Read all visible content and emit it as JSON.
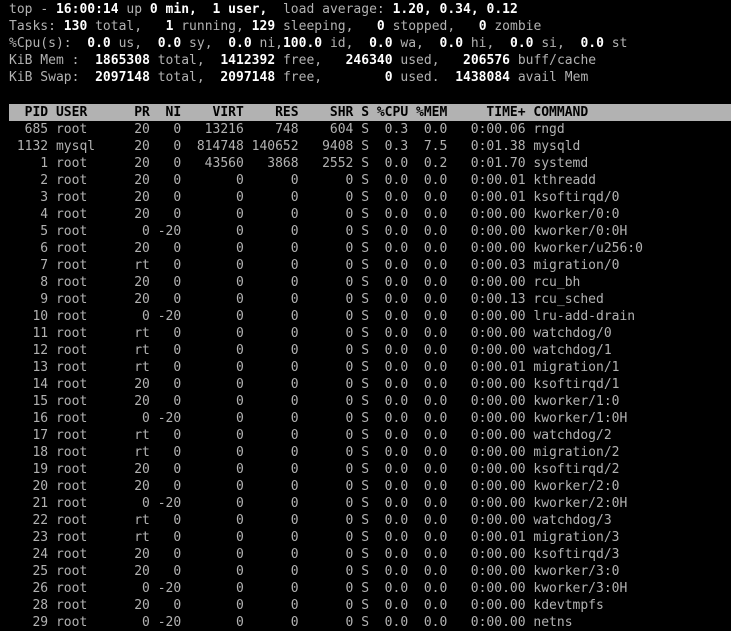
{
  "window": {
    "title": "top",
    "background_color": "#000000",
    "foreground_color": "#b2b2b2",
    "highlight_color": "#ffffff",
    "header_bar_bg": "#b2b2b2",
    "header_bar_fg": "#000000"
  },
  "summary": {
    "uptime_line": {
      "program": "top",
      "separator": "-",
      "time": "16:00:14",
      "up_label": "up",
      "uptime": "0 min,",
      "users": "1 user,",
      "load_label": "load average:",
      "load_1": "1.20,",
      "load_5": "0.34,",
      "load_15": "0.12",
      "full": "top - 16:00:14 up 0 min,  1 user,  load average: 1.20, 0.34, 0.12"
    },
    "tasks_line": {
      "label": "Tasks:",
      "total": "130",
      "total_label": "total,",
      "running": "1",
      "running_label": "running,",
      "sleeping": "129",
      "sleeping_label": "sleeping,",
      "stopped": "0",
      "stopped_label": "stopped,",
      "zombie": "0",
      "zombie_label": "zombie",
      "full": "Tasks: 130 total,   1 running, 129 sleeping,   0 stopped,   0 zombie"
    },
    "cpu_line": {
      "label": "%Cpu(s):",
      "us": "0.0",
      "us_label": "us,",
      "sy": "0.0",
      "sy_label": "sy,",
      "ni": "0.0",
      "ni_label": "ni,",
      "id": "100.0",
      "id_label": "id,",
      "wa": "0.0",
      "wa_label": "wa,",
      "hi": "0.0",
      "hi_label": "hi,",
      "si": "0.0",
      "si_label": "si,",
      "st": "0.0",
      "st_label": "st",
      "full": "%Cpu(s):  0.0 us,  0.0 sy,  0.0 ni,100.0 id,  0.0 wa,  0.0 hi,  0.0 si,  0.0 st"
    },
    "mem_line": {
      "label": "KiB Mem :",
      "total": "1865308",
      "total_label": "total,",
      "free": "1412392",
      "free_label": "free,",
      "used": "246340",
      "used_label": "used,",
      "buff_cache": "206576",
      "buff_cache_label": "buff/cache",
      "full": "KiB Mem :  1865308 total,  1412392 free,   246340 used,   206576 buff/cache"
    },
    "swap_line": {
      "label": "KiB Swap:",
      "total": "2097148",
      "total_label": "total,",
      "free": "2097148",
      "free_label": "free,",
      "used": "0",
      "used_label": "used.",
      "avail": "1438084",
      "avail_label": "avail Mem",
      "full": "KiB Swap:  2097148 total,  2097148 free,        0 used.  1438084 avail Mem"
    }
  },
  "table": {
    "columns": [
      "PID",
      "USER",
      "PR",
      "NI",
      "VIRT",
      "RES",
      "SHR",
      "S",
      "%CPU",
      "%MEM",
      "TIME+",
      "COMMAND"
    ],
    "header_text": "  PID USER      PR  NI    VIRT    RES    SHR S %CPU %MEM     TIME+ COMMAND",
    "rows": [
      {
        "pid": "685",
        "user": "root",
        "pr": "20",
        "ni": "0",
        "virt": "13216",
        "res": "748",
        "shr": "604",
        "s": "S",
        "cpu": "0.3",
        "mem": "0.0",
        "time": "0:00.06",
        "command": "rngd"
      },
      {
        "pid": "1132",
        "user": "mysql",
        "pr": "20",
        "ni": "0",
        "virt": "814748",
        "res": "140652",
        "shr": "9408",
        "s": "S",
        "cpu": "0.3",
        "mem": "7.5",
        "time": "0:01.38",
        "command": "mysqld"
      },
      {
        "pid": "1",
        "user": "root",
        "pr": "20",
        "ni": "0",
        "virt": "43560",
        "res": "3868",
        "shr": "2552",
        "s": "S",
        "cpu": "0.0",
        "mem": "0.2",
        "time": "0:01.70",
        "command": "systemd"
      },
      {
        "pid": "2",
        "user": "root",
        "pr": "20",
        "ni": "0",
        "virt": "0",
        "res": "0",
        "shr": "0",
        "s": "S",
        "cpu": "0.0",
        "mem": "0.0",
        "time": "0:00.01",
        "command": "kthreadd"
      },
      {
        "pid": "3",
        "user": "root",
        "pr": "20",
        "ni": "0",
        "virt": "0",
        "res": "0",
        "shr": "0",
        "s": "S",
        "cpu": "0.0",
        "mem": "0.0",
        "time": "0:00.01",
        "command": "ksoftirqd/0"
      },
      {
        "pid": "4",
        "user": "root",
        "pr": "20",
        "ni": "0",
        "virt": "0",
        "res": "0",
        "shr": "0",
        "s": "S",
        "cpu": "0.0",
        "mem": "0.0",
        "time": "0:00.00",
        "command": "kworker/0:0"
      },
      {
        "pid": "5",
        "user": "root",
        "pr": "0",
        "ni": "-20",
        "virt": "0",
        "res": "0",
        "shr": "0",
        "s": "S",
        "cpu": "0.0",
        "mem": "0.0",
        "time": "0:00.00",
        "command": "kworker/0:0H"
      },
      {
        "pid": "6",
        "user": "root",
        "pr": "20",
        "ni": "0",
        "virt": "0",
        "res": "0",
        "shr": "0",
        "s": "S",
        "cpu": "0.0",
        "mem": "0.0",
        "time": "0:00.00",
        "command": "kworker/u256:0"
      },
      {
        "pid": "7",
        "user": "root",
        "pr": "rt",
        "ni": "0",
        "virt": "0",
        "res": "0",
        "shr": "0",
        "s": "S",
        "cpu": "0.0",
        "mem": "0.0",
        "time": "0:00.03",
        "command": "migration/0"
      },
      {
        "pid": "8",
        "user": "root",
        "pr": "20",
        "ni": "0",
        "virt": "0",
        "res": "0",
        "shr": "0",
        "s": "S",
        "cpu": "0.0",
        "mem": "0.0",
        "time": "0:00.00",
        "command": "rcu_bh"
      },
      {
        "pid": "9",
        "user": "root",
        "pr": "20",
        "ni": "0",
        "virt": "0",
        "res": "0",
        "shr": "0",
        "s": "S",
        "cpu": "0.0",
        "mem": "0.0",
        "time": "0:00.13",
        "command": "rcu_sched"
      },
      {
        "pid": "10",
        "user": "root",
        "pr": "0",
        "ni": "-20",
        "virt": "0",
        "res": "0",
        "shr": "0",
        "s": "S",
        "cpu": "0.0",
        "mem": "0.0",
        "time": "0:00.00",
        "command": "lru-add-drain"
      },
      {
        "pid": "11",
        "user": "root",
        "pr": "rt",
        "ni": "0",
        "virt": "0",
        "res": "0",
        "shr": "0",
        "s": "S",
        "cpu": "0.0",
        "mem": "0.0",
        "time": "0:00.00",
        "command": "watchdog/0"
      },
      {
        "pid": "12",
        "user": "root",
        "pr": "rt",
        "ni": "0",
        "virt": "0",
        "res": "0",
        "shr": "0",
        "s": "S",
        "cpu": "0.0",
        "mem": "0.0",
        "time": "0:00.00",
        "command": "watchdog/1"
      },
      {
        "pid": "13",
        "user": "root",
        "pr": "rt",
        "ni": "0",
        "virt": "0",
        "res": "0",
        "shr": "0",
        "s": "S",
        "cpu": "0.0",
        "mem": "0.0",
        "time": "0:00.01",
        "command": "migration/1"
      },
      {
        "pid": "14",
        "user": "root",
        "pr": "20",
        "ni": "0",
        "virt": "0",
        "res": "0",
        "shr": "0",
        "s": "S",
        "cpu": "0.0",
        "mem": "0.0",
        "time": "0:00.00",
        "command": "ksoftirqd/1"
      },
      {
        "pid": "15",
        "user": "root",
        "pr": "20",
        "ni": "0",
        "virt": "0",
        "res": "0",
        "shr": "0",
        "s": "S",
        "cpu": "0.0",
        "mem": "0.0",
        "time": "0:00.00",
        "command": "kworker/1:0"
      },
      {
        "pid": "16",
        "user": "root",
        "pr": "0",
        "ni": "-20",
        "virt": "0",
        "res": "0",
        "shr": "0",
        "s": "S",
        "cpu": "0.0",
        "mem": "0.0",
        "time": "0:00.00",
        "command": "kworker/1:0H"
      },
      {
        "pid": "17",
        "user": "root",
        "pr": "rt",
        "ni": "0",
        "virt": "0",
        "res": "0",
        "shr": "0",
        "s": "S",
        "cpu": "0.0",
        "mem": "0.0",
        "time": "0:00.00",
        "command": "watchdog/2"
      },
      {
        "pid": "18",
        "user": "root",
        "pr": "rt",
        "ni": "0",
        "virt": "0",
        "res": "0",
        "shr": "0",
        "s": "S",
        "cpu": "0.0",
        "mem": "0.0",
        "time": "0:00.00",
        "command": "migration/2"
      },
      {
        "pid": "19",
        "user": "root",
        "pr": "20",
        "ni": "0",
        "virt": "0",
        "res": "0",
        "shr": "0",
        "s": "S",
        "cpu": "0.0",
        "mem": "0.0",
        "time": "0:00.00",
        "command": "ksoftirqd/2"
      },
      {
        "pid": "20",
        "user": "root",
        "pr": "20",
        "ni": "0",
        "virt": "0",
        "res": "0",
        "shr": "0",
        "s": "S",
        "cpu": "0.0",
        "mem": "0.0",
        "time": "0:00.00",
        "command": "kworker/2:0"
      },
      {
        "pid": "21",
        "user": "root",
        "pr": "0",
        "ni": "-20",
        "virt": "0",
        "res": "0",
        "shr": "0",
        "s": "S",
        "cpu": "0.0",
        "mem": "0.0",
        "time": "0:00.00",
        "command": "kworker/2:0H"
      },
      {
        "pid": "22",
        "user": "root",
        "pr": "rt",
        "ni": "0",
        "virt": "0",
        "res": "0",
        "shr": "0",
        "s": "S",
        "cpu": "0.0",
        "mem": "0.0",
        "time": "0:00.00",
        "command": "watchdog/3"
      },
      {
        "pid": "23",
        "user": "root",
        "pr": "rt",
        "ni": "0",
        "virt": "0",
        "res": "0",
        "shr": "0",
        "s": "S",
        "cpu": "0.0",
        "mem": "0.0",
        "time": "0:00.01",
        "command": "migration/3"
      },
      {
        "pid": "24",
        "user": "root",
        "pr": "20",
        "ni": "0",
        "virt": "0",
        "res": "0",
        "shr": "0",
        "s": "S",
        "cpu": "0.0",
        "mem": "0.0",
        "time": "0:00.00",
        "command": "ksoftirqd/3"
      },
      {
        "pid": "25",
        "user": "root",
        "pr": "20",
        "ni": "0",
        "virt": "0",
        "res": "0",
        "shr": "0",
        "s": "S",
        "cpu": "0.0",
        "mem": "0.0",
        "time": "0:00.00",
        "command": "kworker/3:0"
      },
      {
        "pid": "26",
        "user": "root",
        "pr": "0",
        "ni": "-20",
        "virt": "0",
        "res": "0",
        "shr": "0",
        "s": "S",
        "cpu": "0.0",
        "mem": "0.0",
        "time": "0:00.00",
        "command": "kworker/3:0H"
      },
      {
        "pid": "28",
        "user": "root",
        "pr": "20",
        "ni": "0",
        "virt": "0",
        "res": "0",
        "shr": "0",
        "s": "S",
        "cpu": "0.0",
        "mem": "0.0",
        "time": "0:00.00",
        "command": "kdevtmpfs"
      },
      {
        "pid": "29",
        "user": "root",
        "pr": "0",
        "ni": "-20",
        "virt": "0",
        "res": "0",
        "shr": "0",
        "s": "S",
        "cpu": "0.0",
        "mem": "0.0",
        "time": "0:00.00",
        "command": "netns"
      }
    ]
  }
}
